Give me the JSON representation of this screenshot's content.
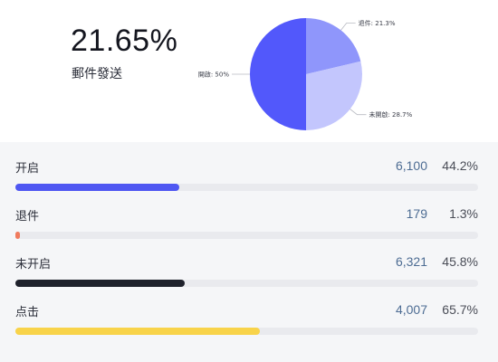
{
  "summary": {
    "value": "21.65%",
    "label": "郵件發送"
  },
  "chart_data": {
    "type": "pie",
    "slices": [
      {
        "label": "退件",
        "value": 21.3,
        "text": "退件: 21.3%",
        "color": "#8f96fb"
      },
      {
        "label": "未開啟",
        "value": 28.7,
        "text": "未開啟: 28.7%",
        "color": "#c3c6fd"
      },
      {
        "label": "開啟",
        "value": 50,
        "text": "開啟: 50%",
        "color": "#5258fb"
      }
    ]
  },
  "metrics": [
    {
      "label": "开启",
      "count": "6,100",
      "pct": "44.2%",
      "fill": 0.355,
      "color": "#4f57f2"
    },
    {
      "label": "退件",
      "count": "179",
      "pct": "1.3%",
      "fill": 0.01,
      "color": "#f07b5e"
    },
    {
      "label": "未开启",
      "count": "6,321",
      "pct": "45.8%",
      "fill": 0.366,
      "color": "#1e212b"
    },
    {
      "label": "点击",
      "count": "4,007",
      "pct": "65.7%",
      "fill": 0.528,
      "color": "#f8d34a"
    }
  ]
}
